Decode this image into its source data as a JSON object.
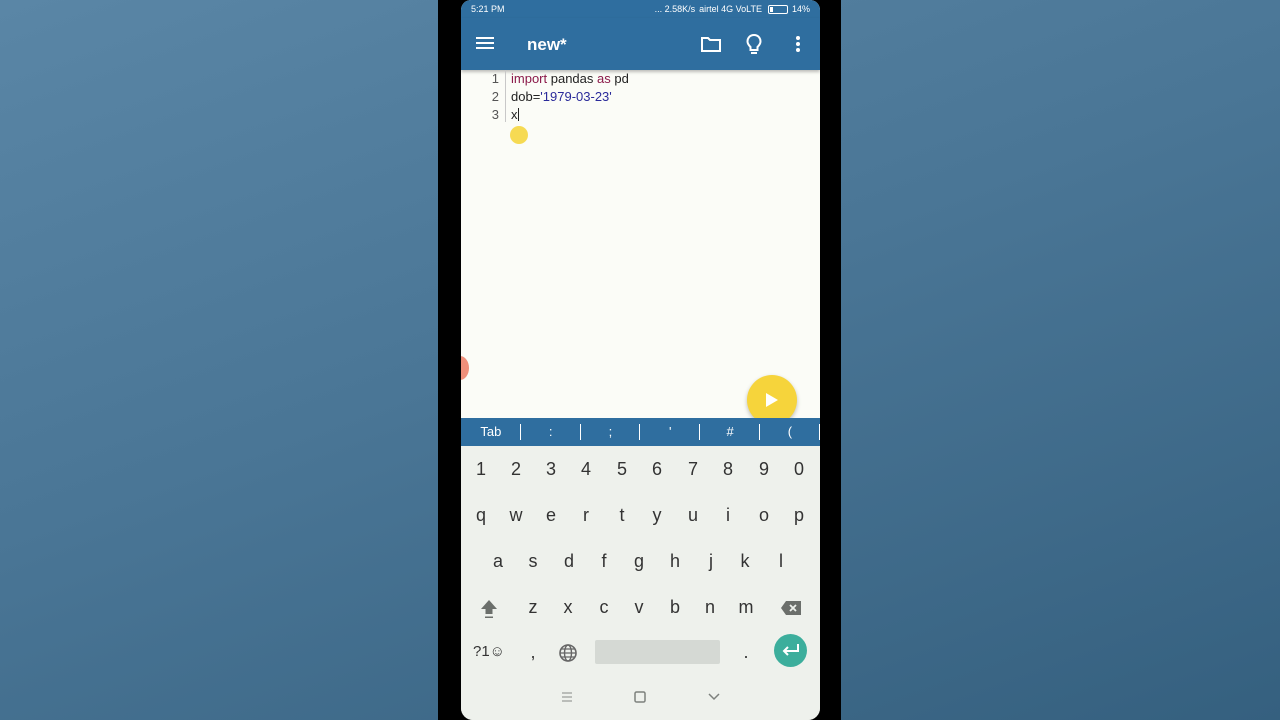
{
  "status_bar": {
    "time": "5:21 PM",
    "speed": "... 2.58K/s",
    "carrier": "airtel 4G VoLTE",
    "battery": "14%"
  },
  "app_bar": {
    "title": "new*",
    "icons": [
      "menu-icon",
      "folder-icon",
      "lightbulb-icon",
      "more-vert-icon"
    ]
  },
  "editor": {
    "lines": [
      {
        "num": "1",
        "tokens": [
          {
            "text": "import",
            "kind": "kw"
          },
          {
            "text": " pandas ",
            "kind": "plain"
          },
          {
            "text": "as",
            "kind": "kw"
          },
          {
            "text": " pd",
            "kind": "plain"
          }
        ]
      },
      {
        "num": "2",
        "tokens": [
          {
            "text": "dob=",
            "kind": "plain"
          },
          {
            "text": "'1979-03-23'",
            "kind": "str"
          }
        ]
      },
      {
        "num": "3",
        "tokens": [
          {
            "text": "x",
            "kind": "plain"
          }
        ]
      }
    ],
    "run_button_icon": "play-icon"
  },
  "extra_keys": [
    "Tab",
    ":",
    ";",
    "'",
    "#",
    "("
  ],
  "keyboard": {
    "row_numbers": [
      "1",
      "2",
      "3",
      "4",
      "5",
      "6",
      "7",
      "8",
      "9",
      "0"
    ],
    "row1": [
      "q",
      "w",
      "e",
      "r",
      "t",
      "y",
      "u",
      "i",
      "o",
      "p"
    ],
    "row2": [
      "a",
      "s",
      "d",
      "f",
      "g",
      "h",
      "j",
      "k",
      "l"
    ],
    "row3": [
      "z",
      "x",
      "c",
      "v",
      "b",
      "n",
      "m"
    ],
    "symbols_label": "?1☺",
    "comma": ",",
    "period": "."
  },
  "colors": {
    "accent": "#2f6e9f",
    "keyword": "#8b1a4a",
    "string": "#2a2a9a",
    "fab": "#f6d43b",
    "enter": "#3cae9c"
  }
}
